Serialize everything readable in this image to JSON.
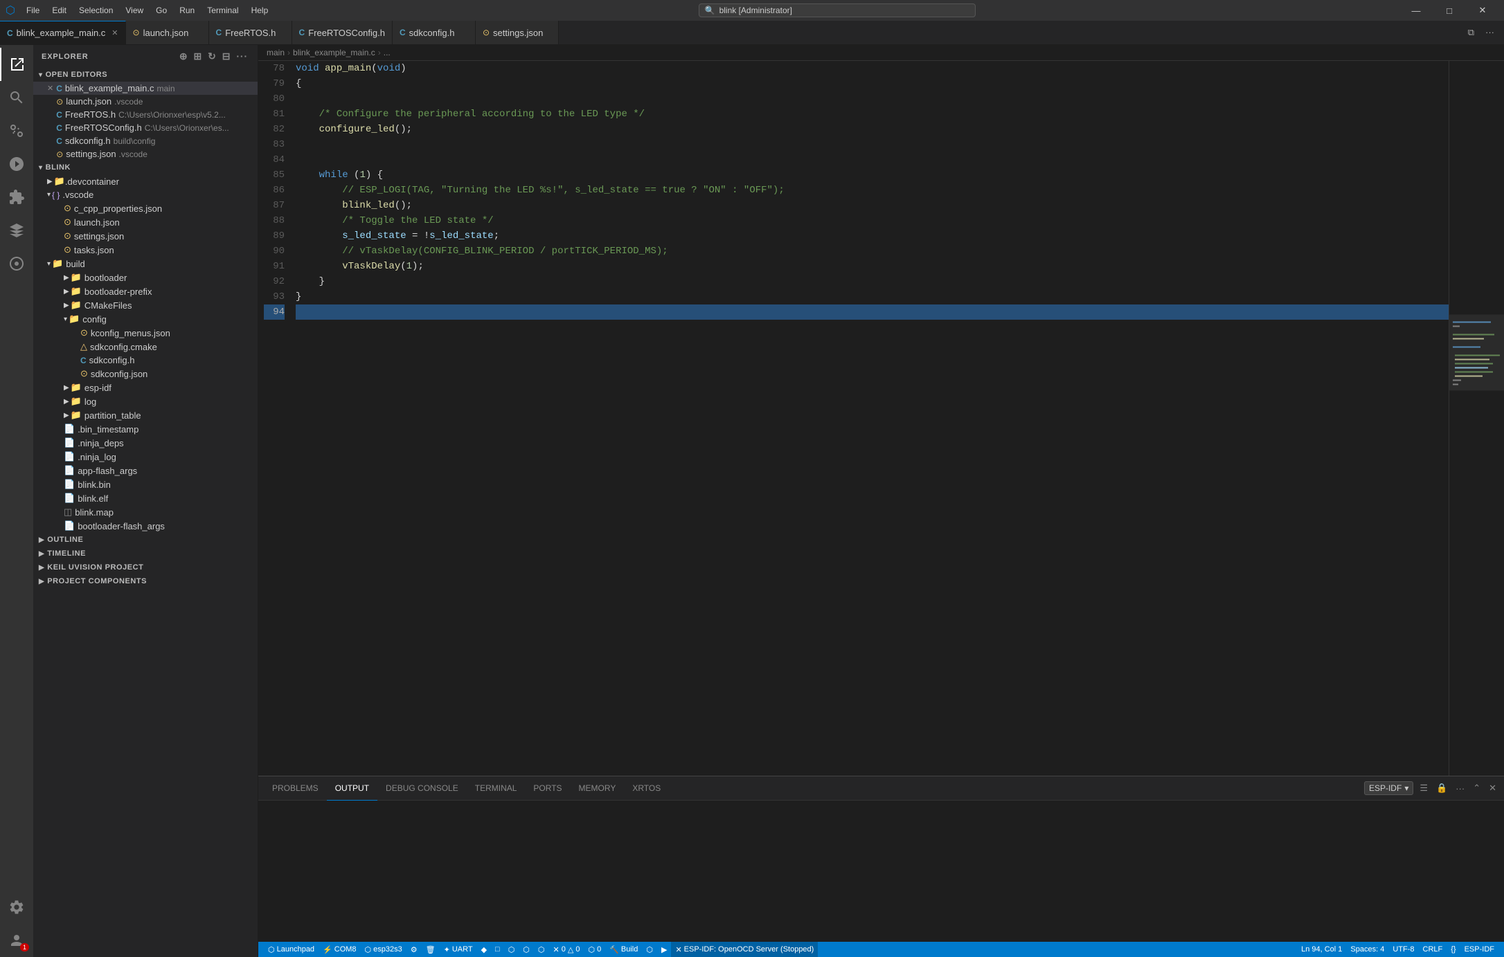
{
  "titleBar": {
    "icon": "⬡",
    "menus": [
      "File",
      "Edit",
      "Selection",
      "View",
      "Go",
      "Run",
      "Terminal",
      "Help"
    ],
    "search": "blink [Administrator]",
    "controls": [
      "—",
      "□",
      "✕"
    ]
  },
  "tabs": [
    {
      "id": "blink_example_main_c",
      "label": "blink_example_main.c",
      "type": "c",
      "active": true,
      "modified": false
    },
    {
      "id": "launch_json",
      "label": "launch.json",
      "type": "json",
      "active": false
    },
    {
      "id": "FreeRTOS_h",
      "label": "FreeRTOS.h",
      "type": "h",
      "active": false
    },
    {
      "id": "FreeRTOSConfig_h",
      "label": "FreeRTOSConfig.h",
      "type": "h",
      "active": false
    },
    {
      "id": "sdkconfig_h",
      "label": "sdkconfig.h",
      "type": "h",
      "active": false
    },
    {
      "id": "settings_json",
      "label": "settings.json",
      "type": "json",
      "active": false
    }
  ],
  "breadcrumb": [
    "main",
    "blink_example_main.c",
    "..."
  ],
  "sidebar": {
    "title": "EXPLORER",
    "sections": {
      "openEditors": {
        "label": "OPEN EDITORS",
        "items": [
          {
            "name": "blink_example_main.c",
            "type": "c",
            "suffix": "main"
          },
          {
            "name": "launch.json",
            "type": "json",
            "suffix": ".vscode"
          },
          {
            "name": "FreeRTOS.h",
            "type": "h",
            "suffix": "C:\\Users\\Orionxer\\esp\\v5.2..."
          },
          {
            "name": "FreeRTOSConfig.h",
            "type": "h",
            "suffix": "C:\\Users\\Orionxer\\es..."
          },
          {
            "name": "sdkconfig.h",
            "type": "h",
            "suffix": "build\\config"
          },
          {
            "name": "settings.json",
            "type": "json",
            "suffix": ".vscode"
          }
        ]
      },
      "blink": {
        "label": "BLINK",
        "items": [
          {
            "name": ".devcontainer",
            "type": "folder",
            "indent": 1
          },
          {
            "name": ".vscode",
            "type": "folder",
            "indent": 1,
            "open": true,
            "children": [
              {
                "name": "c_cpp_properties.json",
                "type": "json",
                "indent": 2
              },
              {
                "name": "launch.json",
                "type": "json",
                "indent": 2
              },
              {
                "name": "settings.json",
                "type": "json",
                "indent": 2
              },
              {
                "name": "tasks.json",
                "type": "json",
                "indent": 2
              }
            ]
          },
          {
            "name": "build",
            "type": "folder",
            "indent": 1,
            "open": true,
            "children": [
              {
                "name": "bootloader",
                "type": "folder",
                "indent": 2
              },
              {
                "name": "bootloader-prefix",
                "type": "folder",
                "indent": 2
              },
              {
                "name": "CMakeFiles",
                "type": "folder",
                "indent": 2
              },
              {
                "name": "config",
                "type": "folder",
                "indent": 2,
                "open": true,
                "subchildren": [
                  {
                    "name": "kconfig_menus.json",
                    "type": "json",
                    "indent": 3
                  },
                  {
                    "name": "sdkconfig.cmake",
                    "type": "cmake",
                    "indent": 3
                  },
                  {
                    "name": "sdkconfig.h",
                    "type": "h",
                    "indent": 3
                  },
                  {
                    "name": "sdkconfig.json",
                    "type": "json",
                    "indent": 3
                  }
                ]
              },
              {
                "name": "esp-idf",
                "type": "folder",
                "indent": 2
              },
              {
                "name": "log",
                "type": "folder",
                "indent": 2
              },
              {
                "name": "partition_table",
                "type": "folder",
                "indent": 2
              },
              {
                "name": ".bin_timestamp",
                "type": "file",
                "indent": 2
              },
              {
                "name": ".ninja_deps",
                "type": "file",
                "indent": 2
              },
              {
                "name": ".ninja_log",
                "type": "file",
                "indent": 2
              },
              {
                "name": "app-flash_args",
                "type": "file",
                "indent": 2
              },
              {
                "name": "blink.bin",
                "type": "file",
                "indent": 2
              },
              {
                "name": "blink.elf",
                "type": "file",
                "indent": 2
              },
              {
                "name": "blink.map",
                "type": "file",
                "indent": 2
              },
              {
                "name": "bootloader-flash_args",
                "type": "file",
                "indent": 2
              }
            ]
          }
        ]
      },
      "outline": {
        "label": "OUTLINE"
      },
      "timeline": {
        "label": "TIMELINE"
      },
      "keilVision": {
        "label": "KEIL UVISION PROJECT"
      },
      "projectComponents": {
        "label": "PROJECT COMPONENTS"
      }
    }
  },
  "editor": {
    "filename": "blink_example_main.c",
    "lines": [
      {
        "num": 78,
        "content": "void app_main(void)",
        "tokens": [
          {
            "text": "void ",
            "class": "kw"
          },
          {
            "text": "app_main",
            "class": "fn"
          },
          {
            "text": "(",
            "class": "punct"
          },
          {
            "text": "void",
            "class": "kw"
          },
          {
            "text": ")",
            "class": "punct"
          }
        ]
      },
      {
        "num": 79,
        "content": "{"
      },
      {
        "num": 80,
        "content": ""
      },
      {
        "num": 81,
        "content": "    /* Configure the peripheral according to the LED type */",
        "isComment": true
      },
      {
        "num": 82,
        "content": "    configure_led();"
      },
      {
        "num": 83,
        "content": ""
      },
      {
        "num": 84,
        "content": ""
      },
      {
        "num": 85,
        "content": "    while (1) {"
      },
      {
        "num": 86,
        "content": "        // ESP_LOGI(TAG, \"Turning the LED %s!\", s_led_state == true ? \"ON\" : \"OFF\");",
        "isLineComment": true
      },
      {
        "num": 87,
        "content": "        blink_led();"
      },
      {
        "num": 88,
        "content": "        /* Toggle the LED state */",
        "isComment": true
      },
      {
        "num": 89,
        "content": "        s_led_state = !s_led_state;"
      },
      {
        "num": 90,
        "content": "        // vTaskDelay(CONFIG_BLINK_PERIOD / portTICK_PERIOD_MS);",
        "isLineComment": true
      },
      {
        "num": 91,
        "content": "        vTaskDelay(1);"
      },
      {
        "num": 92,
        "content": "    }"
      },
      {
        "num": 93,
        "content": "}"
      },
      {
        "num": 94,
        "content": "",
        "isCurrentLine": true
      }
    ]
  },
  "panel": {
    "tabs": [
      "PROBLEMS",
      "OUTPUT",
      "DEBUG CONSOLE",
      "TERMINAL",
      "PORTS",
      "MEMORY",
      "XRTOS"
    ],
    "activeTab": "OUTPUT",
    "dropdown": "ESP-IDF",
    "content": ""
  },
  "statusBar": {
    "left": [
      {
        "icon": "⬡",
        "text": "Launchpad"
      },
      {
        "icon": "⚡",
        "text": "COM8"
      },
      {
        "icon": "⬡",
        "text": ""
      },
      {
        "icon": "⚙",
        "text": ""
      },
      {
        "icon": "🗑",
        "text": ""
      },
      {
        "icon": "✦",
        "text": "UART"
      },
      {
        "icon": "◆",
        "text": ""
      },
      {
        "icon": "□",
        "text": ""
      },
      {
        "icon": "⬡",
        "text": ""
      },
      {
        "icon": "⬡",
        "text": ""
      },
      {
        "icon": "⬡",
        "text": ""
      },
      {
        "icon": "⚠",
        "text": "0"
      },
      {
        "icon": "△",
        "text": "0"
      },
      {
        "icon": "⬡",
        "text": "0"
      },
      {
        "icon": "🔨",
        "text": "Build"
      },
      {
        "icon": "⬡",
        "text": ""
      },
      {
        "icon": "▶",
        "text": ""
      }
    ],
    "errorInfo": "✕ ESP-IDF: OpenOCD Server (Stopped)",
    "right": [
      {
        "text": "Ln 94, Col 1"
      },
      {
        "text": "Spaces: 4"
      },
      {
        "text": "UTF-8"
      },
      {
        "text": "CRLF"
      },
      {
        "text": "{}"
      },
      {
        "text": "ESP-IDF"
      }
    ]
  }
}
